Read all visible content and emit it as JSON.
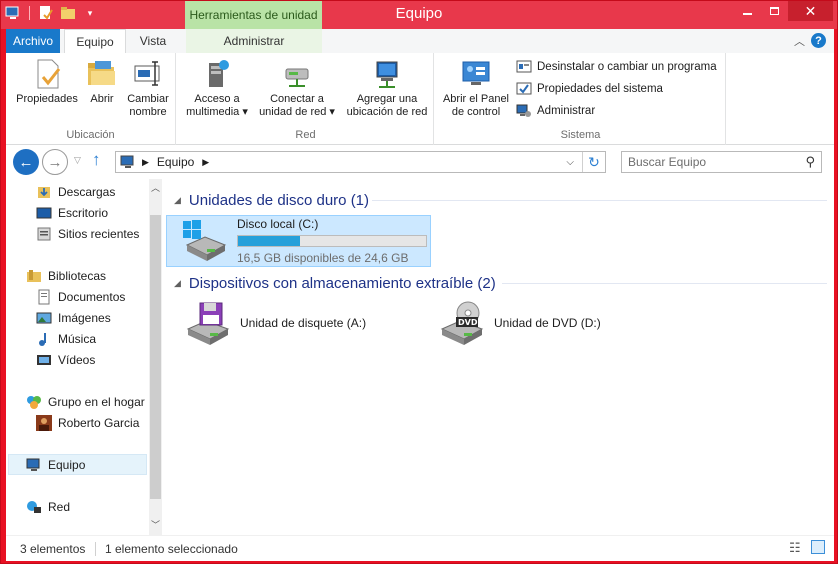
{
  "window": {
    "title": "Equipo",
    "context_tab_header": "Herramientas de unidad",
    "accent": "#e81123"
  },
  "ribbon": {
    "tabs": [
      {
        "label": "Archivo"
      },
      {
        "label": "Equipo"
      },
      {
        "label": "Vista"
      },
      {
        "label": "Administrar"
      }
    ],
    "groups": {
      "ubicacion": {
        "label": "Ubicación",
        "buttons": [
          {
            "label_1": "Propiedades",
            "label_2": ""
          },
          {
            "label_1": "Abrir",
            "label_2": ""
          },
          {
            "label_1": "Cambiar",
            "label_2": "nombre"
          }
        ]
      },
      "red": {
        "label": "Red",
        "buttons": [
          {
            "label_1": "Acceso a",
            "label_2": "multimedia ▾"
          },
          {
            "label_1": "Conectar a",
            "label_2": "unidad de red ▾"
          },
          {
            "label_1": "Agregar una",
            "label_2": "ubicación de red"
          }
        ]
      },
      "sistema": {
        "label": "Sistema",
        "big_button": {
          "label_1": "Abrir el Panel",
          "label_2": "de control"
        },
        "small_buttons": [
          {
            "label": "Desinstalar o cambiar un programa"
          },
          {
            "label": "Propiedades del sistema"
          },
          {
            "label": "Administrar"
          }
        ]
      }
    }
  },
  "address": {
    "path": "Equipo",
    "search_placeholder": "Buscar Equipo"
  },
  "nav": {
    "items": [
      {
        "label": "Descargas"
      },
      {
        "label": "Escritorio"
      },
      {
        "label": "Sitios recientes"
      },
      {
        "label": "Bibliotecas"
      },
      {
        "label": "Documentos"
      },
      {
        "label": "Imágenes"
      },
      {
        "label": "Música"
      },
      {
        "label": "Vídeos"
      },
      {
        "label": "Grupo en el hogar"
      },
      {
        "label": "Roberto Garcia"
      },
      {
        "label": "Equipo"
      },
      {
        "label": "Red"
      }
    ]
  },
  "content": {
    "sections": [
      {
        "title": "Unidades de disco duro (1)"
      },
      {
        "title": "Dispositivos con almacenamiento extraíble (2)"
      }
    ],
    "drives": [
      {
        "name": "Disco local (C:)",
        "free_text": "16,5 GB disponibles de 24,6 GB",
        "used_fraction": 0.33
      },
      {
        "name": "Unidad de disquete (A:)"
      },
      {
        "name": "Unidad de DVD (D:)",
        "badge": "DVD"
      }
    ]
  },
  "status": {
    "count": "3 elementos",
    "selected": "1 elemento seleccionado"
  }
}
